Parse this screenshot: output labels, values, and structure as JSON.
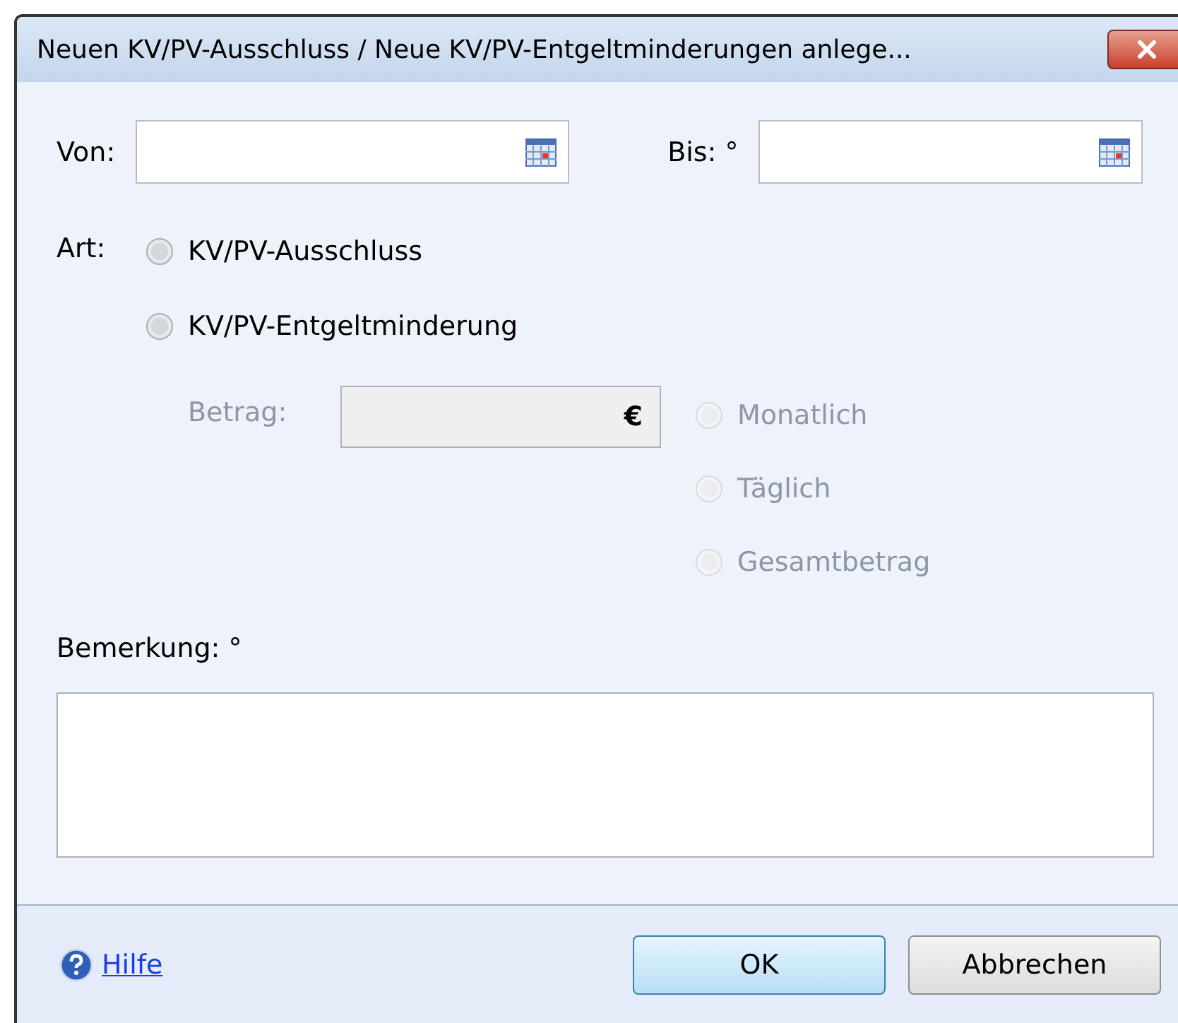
{
  "window": {
    "title": "Neuen KV/PV-Ausschluss / Neue KV/PV-Entgeltminderungen anlege..."
  },
  "von": {
    "label": "Von:"
  },
  "bis": {
    "label": "Bis: °"
  },
  "art": {
    "label": "Art:",
    "options": [
      {
        "label": "KV/PV-Ausschluss",
        "selected": false
      },
      {
        "label": "KV/PV-Entgeltminderung",
        "selected": false
      }
    ]
  },
  "betrag": {
    "label": "Betrag:",
    "currency": "€",
    "disabled": true
  },
  "period_options": [
    {
      "label": "Monatlich",
      "selected": false,
      "disabled": true
    },
    {
      "label": "Täglich",
      "selected": false,
      "disabled": true
    },
    {
      "label": "Gesamtbetrag",
      "selected": false,
      "disabled": true
    }
  ],
  "bemerkung": {
    "label": "Bemerkung: °"
  },
  "help_link": "Hilfe",
  "buttons": [
    {
      "label": "OK",
      "kind": "default"
    },
    {
      "label": "Abbrechen",
      "kind": "normal"
    }
  ]
}
